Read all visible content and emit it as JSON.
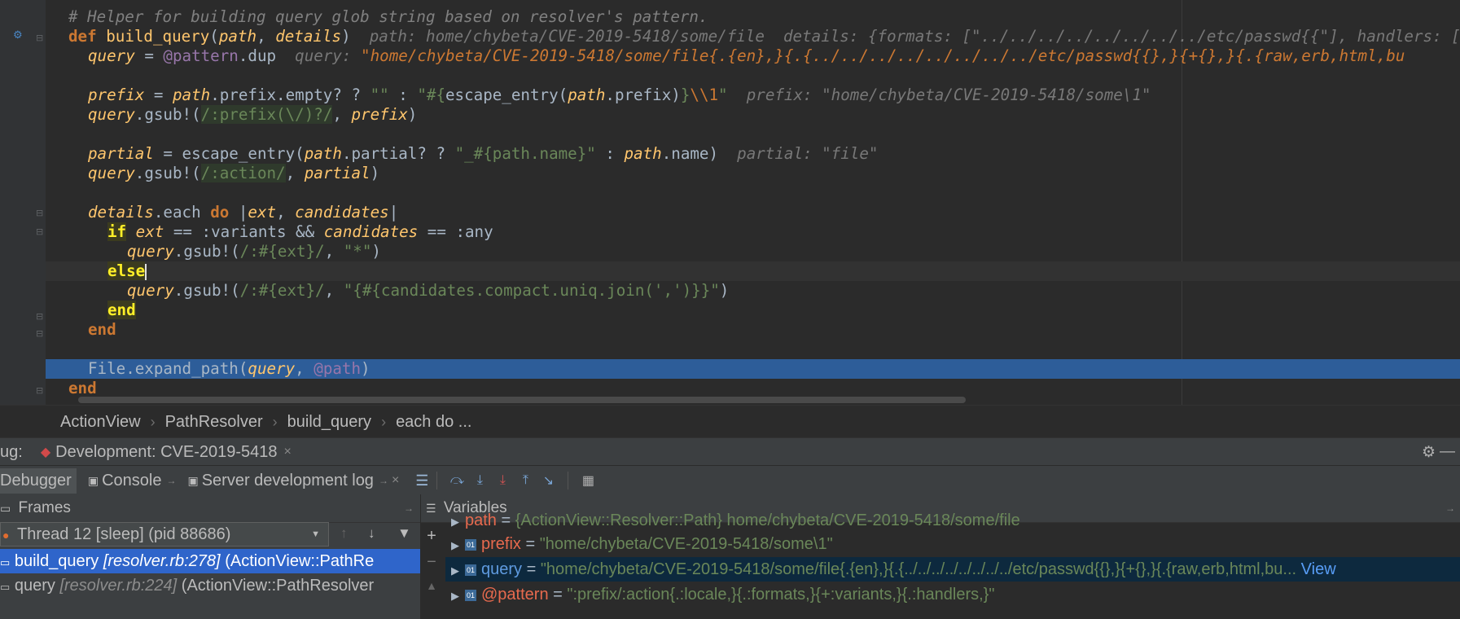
{
  "editor": {
    "lines": {
      "l1": "# Helper for building query glob string based on resolver's pattern.",
      "l2_kw": "def",
      "l2_fn": "build_query",
      "l2_p1": "path",
      "l2_p2": "details",
      "l2_hint": "path: home/chybeta/CVE-2019-5418/some/file  details: {formats: [\"../../../../../../../../etc/passwd{{\"], handlers: [",
      "l3_var": "query",
      "l3_ivar": "@pattern",
      "l3_rest": ".dup",
      "l3_hint_label": "query: ",
      "l3_hint_val": "\"home/chybeta/CVE-2019-5418/some/file{.{en},}{.{../../../../../../../../etc/passwd{{},}{+{},}{.{raw,erb,html,bu",
      "l5_var": "prefix",
      "l5_a": " = ",
      "l5_path": "path",
      "l5_b": ".prefix.empty? ? ",
      "l5_str1": "\"\"",
      "l5_c": " : ",
      "l5_str2a": "\"#{",
      "l5_call": "escape_entry(",
      "l5_path2": "path",
      "l5_d": ".prefix)",
      "l5_str2b": "}",
      "l5_esc": "\\\\1",
      "l5_str2c": "\"",
      "l5_hint": "prefix: \"home/chybeta/CVE-2019-5418/some\\1\"",
      "l6_var": "query",
      "l6_a": ".gsub!(",
      "l6_rx": "/:prefix(\\/)?/",
      "l6_b": ", ",
      "l6_var2": "prefix",
      "l6_c": ")",
      "l8_var": "partial",
      "l8_a": " = escape_entry(",
      "l8_path": "path",
      "l8_b": ".partial? ? ",
      "l8_str": "\"_#{path.name}\"",
      "l8_c": " : ",
      "l8_path2": "path",
      "l8_d": ".name)",
      "l8_hint": "partial: \"file\"",
      "l9_var": "query",
      "l9_a": ".gsub!(",
      "l9_rx": "/:action/",
      "l9_b": ", ",
      "l9_var2": "partial",
      "l9_c": ")",
      "l11_var": "details",
      "l11_a": ".each ",
      "l11_kw": "do",
      "l11_b": " |",
      "l11_v1": "ext",
      "l11_c": ", ",
      "l11_v2": "candidates",
      "l11_d": "|",
      "l12_kw": "if",
      "l12_v1": "ext",
      "l12_a": " == :variants && ",
      "l12_v2": "candidates",
      "l12_b": " == :any",
      "l13_var": "query",
      "l13_a": ".gsub!(",
      "l13_rx": "/:#{ext}/",
      "l13_b": ", ",
      "l13_str": "\"*\"",
      "l13_c": ")",
      "l14_kw": "else",
      "l15_var": "query",
      "l15_a": ".gsub!(",
      "l15_rx": "/:#{ext}/",
      "l15_b": ", ",
      "l15_str": "\"{#{candidates.compact.uniq.join(',')}}\"",
      "l15_c": ")",
      "l16_kw": "end",
      "l17_kw": "end",
      "l19_a": "File.expand_path(",
      "l19_var": "query",
      "l19_b": ", ",
      "l19_ivar": "@path",
      "l19_c": ")",
      "l20_kw": "end"
    }
  },
  "breadcrumbs": [
    "ActionView",
    "PathResolver",
    "build_query",
    "each do ..."
  ],
  "debug": {
    "label": "ug:",
    "config": "Development: CVE-2019-5418",
    "tabs": {
      "debugger": "Debugger",
      "console": "Console",
      "server_log": "Server development log"
    },
    "frames_title": "Frames",
    "variables_title": "Variables",
    "thread": "Thread 12 [sleep] (pid 88686)",
    "frames": [
      {
        "method": "build_query",
        "loc": "[resolver.rb:278]",
        "cls": "(ActionView::PathRe"
      },
      {
        "method": "query",
        "loc": "[resolver.rb:224]",
        "cls": "(ActionView::PathResolver"
      }
    ],
    "variables": [
      {
        "name": "path",
        "eq": " = ",
        "value": "{ActionView::Resolver::Path} home/chybeta/CVE-2019-5418/some/file"
      },
      {
        "name": "prefix",
        "eq": " = ",
        "value": "\"home/chybeta/CVE-2019-5418/some\\1\""
      },
      {
        "name": "query",
        "eq": " = ",
        "value": "\"home/chybeta/CVE-2019-5418/some/file{.{en},}{.{../../../../../../../../etc/passwd{{},}{+{},}{.{raw,erb,html,bu...",
        "link": "View"
      },
      {
        "name": "@pattern",
        "eq": " = ",
        "value": "\":prefix/:action{.:locale,}{.:formats,}{+:variants,}{.:handlers,}\""
      }
    ]
  },
  "colors": {
    "exec_line": "#2d5d99",
    "frame_selected": "#2f65ca",
    "variable_selected": "#0d293e"
  }
}
